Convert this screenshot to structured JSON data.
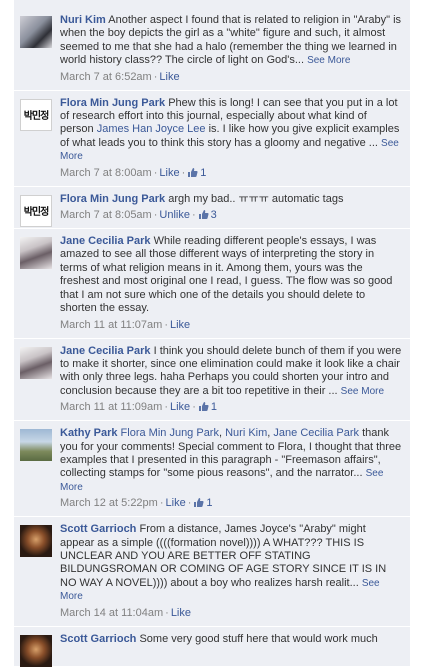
{
  "comments": [
    {
      "author": "Nuri Kim",
      "avatar": "nuri-kim-avatar",
      "text": "Another aspect I found that is related to religion in \"Araby\" is when the boy depicts the girl as a \"white\" figure and such, it almost seemed to me that she had a halo (remember the thing we learned in world history class?? The circle of light on God's...",
      "see_more": "See More",
      "timestamp": "March 7 at 6:52am",
      "action": "Like",
      "likes": ""
    },
    {
      "author": "Flora Min Jung Park",
      "avatar": "flora-avatar",
      "text_before": "Phew this is long! I can see that you put in a lot of research effort into this journal, especially about what kind of person ",
      "mention": "James Han Joyce Lee",
      "text_after": " is. I like how you give explicit examples of what leads you to think this story has a gloomy and negative ...",
      "see_more": "See More",
      "timestamp": "March 7 at 8:00am",
      "action": "Like",
      "likes": "1"
    },
    {
      "author": "Flora Min Jung Park",
      "avatar": "flora-avatar",
      "text": "argh my bad.. ㅠㅠㅠ automatic tags",
      "timestamp": "March 7 at 8:05am",
      "action": "Unlike",
      "likes": "3"
    },
    {
      "author": "Jane Cecilia Park",
      "avatar": "jane-avatar",
      "text": "While reading different people's essays, I was amazed to see all those different ways of interpreting the story in terms of what religion means in it. Among them, yours was the freshest and most original one I read, I guess. The flow was so good that I am not sure which one of the details you should delete to shorten the essay.",
      "timestamp": "March 11 at 11:07am",
      "action": "Like",
      "likes": ""
    },
    {
      "author": "Jane Cecilia Park",
      "avatar": "jane-avatar",
      "text": "I think you should delete bunch of them if you were to make it shorter, since one elimination could make it look like a chair with only three legs. haha Perhaps you could shorten your intro and conclusion because they are a bit too repetitive in their ...",
      "see_more": "See More",
      "timestamp": "March 11 at 11:09am",
      "action": "Like",
      "likes": "1"
    },
    {
      "author": "Kathy Park",
      "avatar": "kathy-avatar",
      "mentions": [
        "Flora Min Jung Park",
        "Nuri Kim",
        "Jane Cecilia Park"
      ],
      "text": "thank you for your comments! Special comment to Flora, I thought that three examples that I presented in this paragraph - \"Freemason affairs\", collecting stamps for \"some pious reasons\", and the narrator...",
      "see_more": "See More",
      "timestamp": "March 12 at 5:22pm",
      "action": "Like",
      "likes": "1"
    },
    {
      "author": "Scott Garrioch",
      "avatar": "scott-avatar",
      "text": "From a distance, James Joyce's \"Araby\" might appear as a simple ((((formation novel)))) A WHAT??? THIS IS UNCLEAR AND YOU ARE BETTER OFF STATING BILDUNGSROMAN OR COMING OF AGE STORY SINCE IT IS IN NO WAY A NOVEL)))) about a boy who realizes harsh realit...",
      "see_more": "See More",
      "timestamp": "March 14 at 11:04am",
      "action": "Like",
      "likes": ""
    },
    {
      "author": "Scott Garrioch",
      "avatar": "scott-avatar",
      "text": "Some very good stuff here that would work much"
    }
  ],
  "flora_avatar_text": "박민정",
  "icons": {
    "like": "thumbs-up-icon"
  },
  "colors": {
    "link": "#3b5998",
    "comment_bg": "#edeff4",
    "meta": "#808080"
  }
}
